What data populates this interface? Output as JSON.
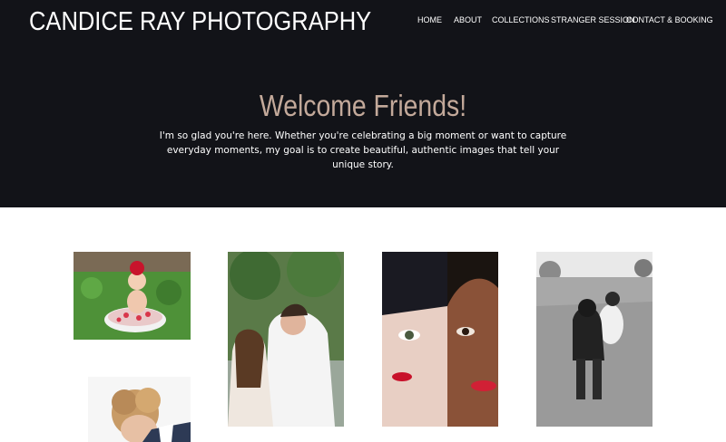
{
  "site": {
    "title": "CANDICE RAY PHOTOGRAPHY"
  },
  "nav": {
    "items": [
      {
        "label": "HOME"
      },
      {
        "label": "ABOUT"
      },
      {
        "label": "COLLECTIONS"
      },
      {
        "label": "STRANGER SESSION"
      },
      {
        "label": "CONTACT & BOOKING"
      }
    ]
  },
  "hero": {
    "heading": "Welcome Friends!",
    "intro": "I'm so glad you're here. Whether you're celebrating a big moment or want to capture everyday moments, my goal is to create beautiful, authentic images that tell your unique story."
  },
  "colors": {
    "header_bg": "#121318",
    "heading_accent": "#c3a99a",
    "page_bg": "#ffffff"
  },
  "gallery": {
    "photos": [
      {
        "icon": "baby-in-milk-bath-photo"
      },
      {
        "icon": "wedding-couple-photo"
      },
      {
        "icon": "two-women-faces-photo"
      },
      {
        "icon": "women-running-field-photo"
      },
      {
        "icon": "curly-hair-portrait-photo"
      }
    ]
  }
}
